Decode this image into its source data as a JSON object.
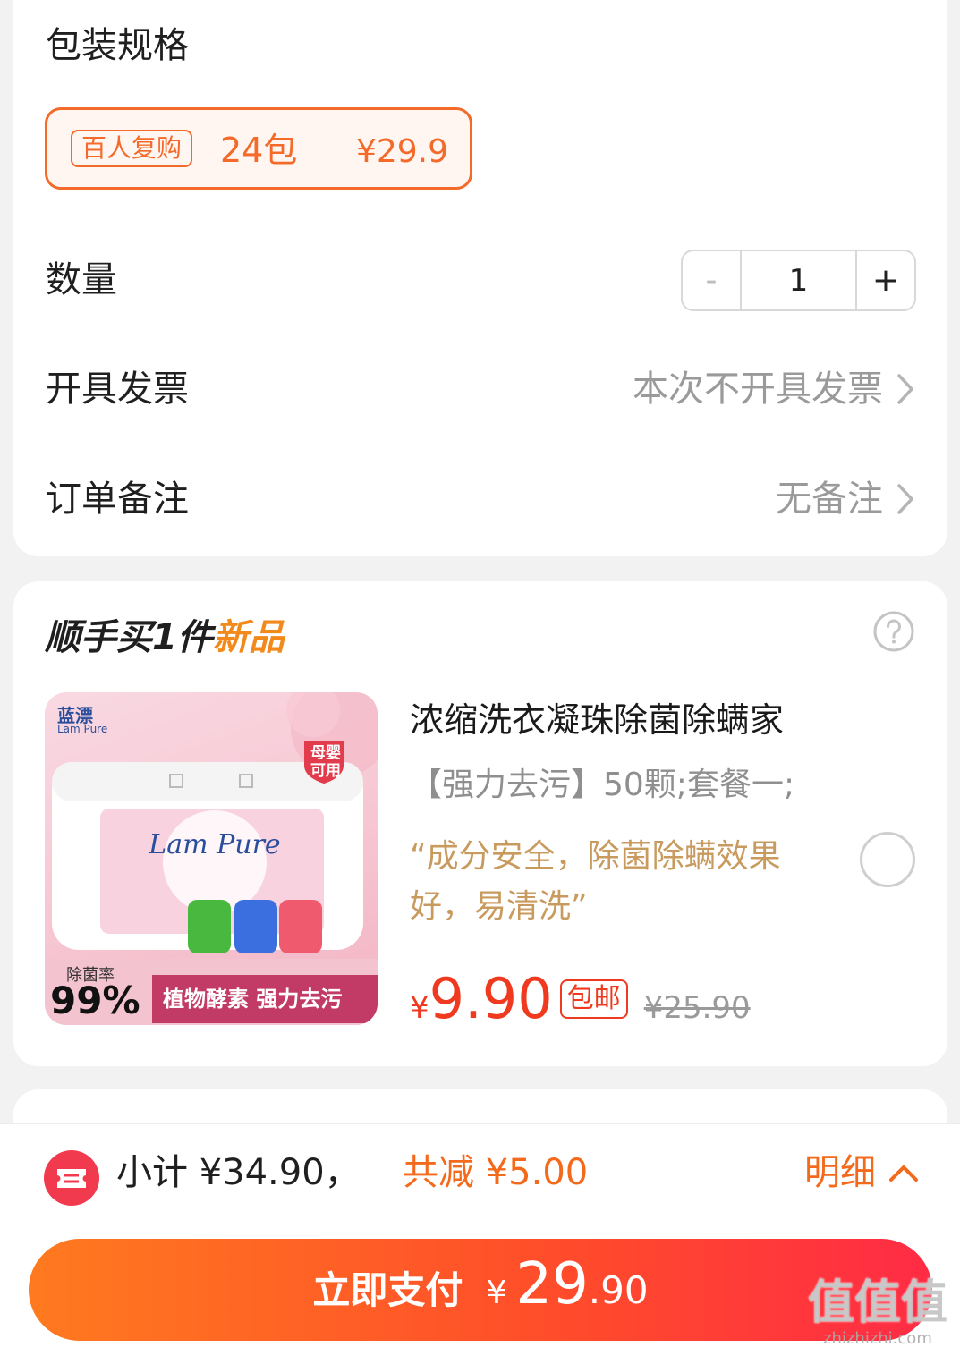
{
  "order": {
    "spec_title": "包装规格",
    "spec_option": {
      "badge": "百人复购",
      "quantity": "24包",
      "price": "¥29.9"
    },
    "qty_label": "数量",
    "qty_minus": "-",
    "qty_value": "1",
    "qty_plus": "+",
    "invoice_label": "开具发票",
    "invoice_value": "本次不开具发票",
    "note_label": "订单备注",
    "note_value": "无备注"
  },
  "addon": {
    "title_prefix": "顺手买1件",
    "title_tag": "新品",
    "product": {
      "name": "浓缩洗衣凝珠除菌除螨家",
      "spec": "【强力去污】50颗;套餐一;",
      "quote": "“成分安全，除菌除螨效果好，易清洗”",
      "price_currency": "¥",
      "price": "9.90",
      "shipping_tag": "包邮",
      "original_price": "¥25.90",
      "image": {
        "brand": "蓝漂",
        "brand_en": "Lam Pure",
        "badge": "母婴可用",
        "stat_label": "除菌率",
        "stat_value": "99%",
        "banner": "植物酵素 强力去污"
      }
    }
  },
  "footer": {
    "subtotal": "小计 ¥34.90，",
    "discount": "共减 ¥5.00",
    "detail": "明细",
    "pay_label": "立即支付",
    "pay_currency": "¥",
    "pay_int": "29",
    "pay_dec": ".90"
  },
  "watermark": {
    "text": "值值值",
    "url": "zhizhizhi.com"
  },
  "colors": {
    "accent": "#f46a2a",
    "price_red": "#ef3a1f",
    "quote_gold": "#c99a5e"
  }
}
